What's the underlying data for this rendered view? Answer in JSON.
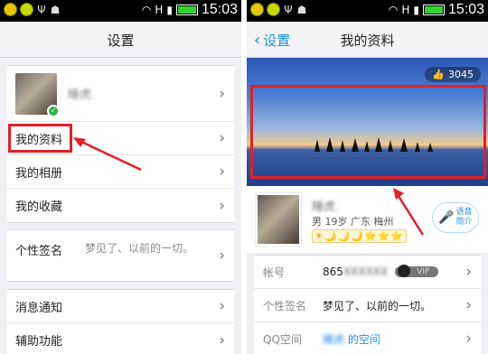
{
  "status_bar": {
    "time": "15:03",
    "signal": "H"
  },
  "left": {
    "nav_title": "设置",
    "profile": {
      "name": "睡虎."
    },
    "items": [
      {
        "label": "我的资料"
      },
      {
        "label": "我的相册"
      },
      {
        "label": "我的收藏"
      }
    ],
    "signature": {
      "label": "个性签名",
      "value": "梦见了、以前的一切。"
    },
    "more_items": [
      {
        "label": "消息通知"
      },
      {
        "label": "辅助功能"
      }
    ]
  },
  "right": {
    "back_label": "设置",
    "nav_title": "我的资料",
    "like_count": "3045",
    "profile": {
      "name": "睡虎.",
      "info": "男 19岁 广东 梅州",
      "level": "☀🌙🌙🌙⭐⭐⭐",
      "voice_line1": "语音",
      "voice_line2": "简介"
    },
    "fields": [
      {
        "label": "帐号",
        "value": "865",
        "hidden": "XXXXXX",
        "badge": "VIP"
      },
      {
        "label": "个性签名",
        "value": "梦见了、以前的一切。"
      },
      {
        "label": "QQ空间",
        "value_prefix": "睡虎.",
        "value": "的空间"
      }
    ]
  },
  "colors": {
    "highlight": "#e21f26",
    "accent": "#1f8fe0"
  }
}
